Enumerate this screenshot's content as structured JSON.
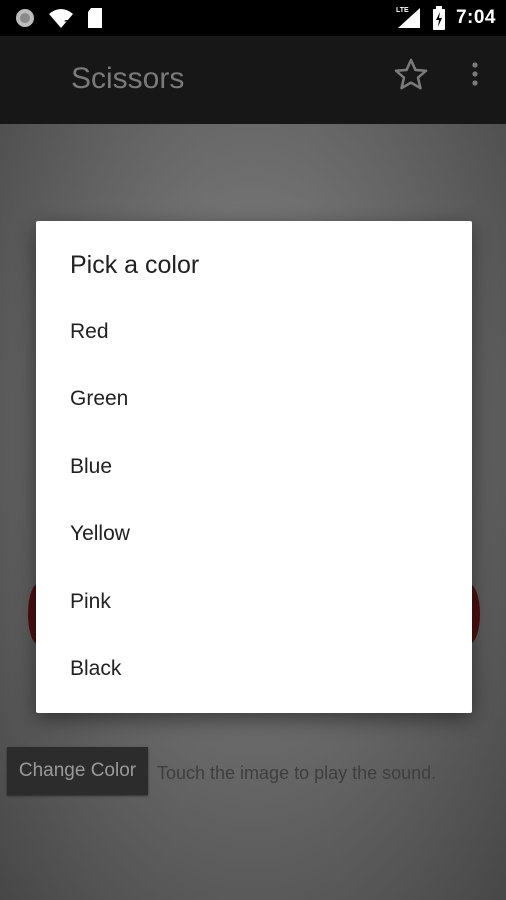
{
  "status_bar": {
    "time": "7:04",
    "network": "LTE",
    "icons": [
      "notification-icon",
      "wifi-unknown-icon",
      "sd-card-icon",
      "signal-icon",
      "battery-charging-icon"
    ]
  },
  "toolbar": {
    "title": "Scissors",
    "icons": [
      "star-outline-icon",
      "overflow-menu-icon"
    ]
  },
  "content": {
    "change_color_label": "Change Color",
    "hint": "Touch the image to play the sound."
  },
  "dialog": {
    "title": "Pick a color",
    "items": [
      {
        "label": "Red"
      },
      {
        "label": "Green"
      },
      {
        "label": "Blue"
      },
      {
        "label": "Yellow"
      },
      {
        "label": "Pink"
      },
      {
        "label": "Black"
      }
    ]
  },
  "colors": {
    "status_bar_bg": "#000000",
    "toolbar_bg": "#171717",
    "dialog_bg": "#ffffff",
    "button_bg": "#2c2c2c"
  }
}
